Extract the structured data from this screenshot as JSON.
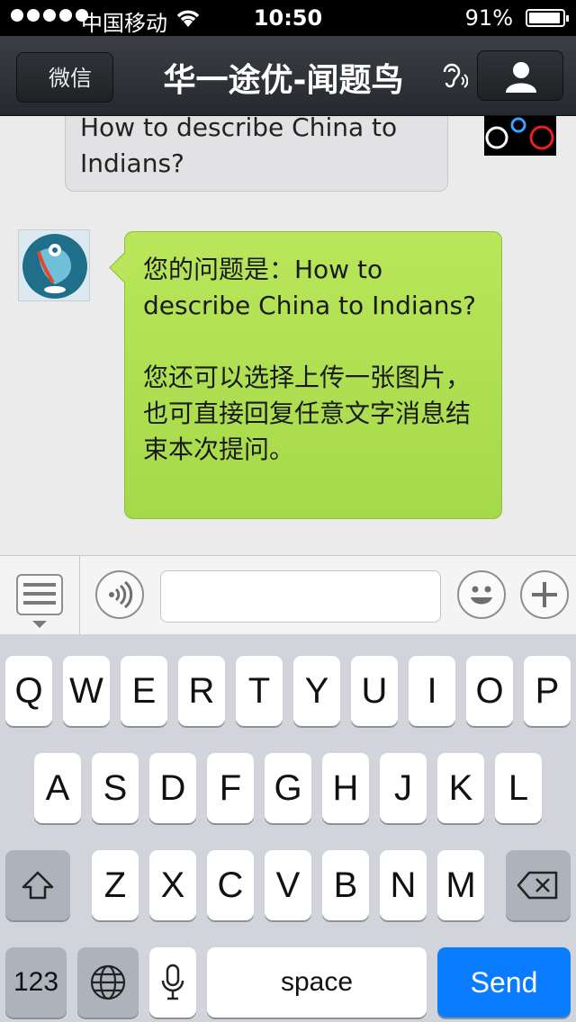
{
  "status_bar": {
    "carrier": "中国移动",
    "time": "10:50",
    "battery": "91%"
  },
  "nav": {
    "back_label": "微信",
    "title": "华一途优-闻题鸟"
  },
  "messages": {
    "user_message": "How to describe China to Indians?",
    "bot_reply": "您的问题是：How to describe China to Indians?\n\n您还可以选择上传一张图片，也可直接回复任意文字消息结束本次提问。"
  },
  "input": {
    "placeholder": "",
    "value": ""
  },
  "keyboard": {
    "row1": [
      "Q",
      "W",
      "E",
      "R",
      "T",
      "Y",
      "U",
      "I",
      "O",
      "P"
    ],
    "row2": [
      "A",
      "S",
      "D",
      "F",
      "G",
      "H",
      "J",
      "K",
      "L"
    ],
    "row3": [
      "Z",
      "X",
      "C",
      "V",
      "B",
      "N",
      "M"
    ],
    "numbers_label": "123",
    "space_label": "space",
    "send_label": "Send"
  },
  "colors": {
    "send_key": "#0a7cff",
    "bot_bubble": "#b1df52",
    "nav_bar": "#2f3337"
  }
}
